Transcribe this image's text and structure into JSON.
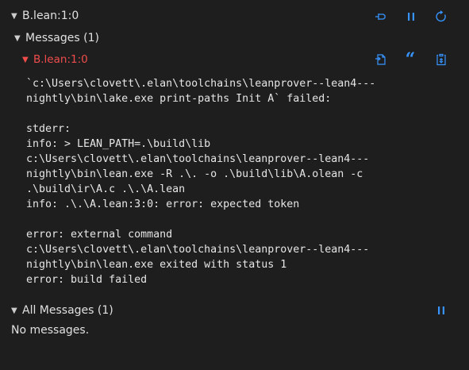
{
  "header": {
    "title": "B.lean:1:0",
    "icons": [
      "pin-icon",
      "pause-icon",
      "refresh-icon"
    ],
    "accent_color": "#3794ff"
  },
  "messages_section": {
    "title": "Messages (1)",
    "message": {
      "location": "B.lean:1:0",
      "location_color": "#f14c4c",
      "icons": [
        "go-to-file-icon",
        "quote-icon",
        "copy-to-clipboard-icon"
      ],
      "lines": [
        "`c:\\Users\\clovett\\.elan\\toolchains\\leanprover--lean4---",
        "nightly\\bin\\lake.exe print-paths Init A` failed:",
        "",
        "stderr:",
        "info: > LEAN_PATH=.\\build\\lib",
        "c:\\Users\\clovett\\.elan\\toolchains\\leanprover--lean4---",
        "nightly\\bin\\lean.exe -R .\\. -o .\\build\\lib\\A.olean -c",
        ".\\build\\ir\\A.c .\\.\\A.lean",
        "info: .\\.\\A.lean:3:0: error: expected token",
        "",
        "error: external command",
        "c:\\Users\\clovett\\.elan\\toolchains\\leanprover--lean4---",
        "nightly\\bin\\lean.exe exited with status 1",
        "error: build failed"
      ]
    }
  },
  "all_messages_section": {
    "title": "All Messages (1)",
    "empty_text": "No messages.",
    "icons": [
      "pause-icon"
    ]
  }
}
